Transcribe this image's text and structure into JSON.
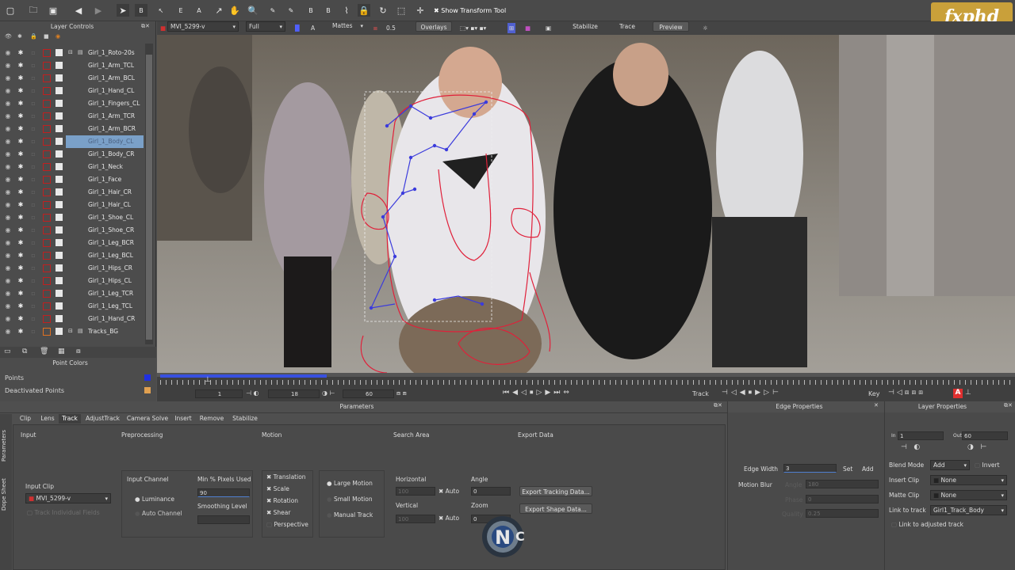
{
  "toolbar": {
    "show_transform_label": "Show Transform Tool",
    "tool_b": "B",
    "tool_e": "E",
    "tool_a": "A",
    "tool_x_b": "B",
    "tool_x_x": "X",
    "tool_b2": "B",
    "tool_b3": "B"
  },
  "logo": {
    "text": "fxphd"
  },
  "viewbar": {
    "clip": "MVI_5299-v",
    "resolution": "Full",
    "a_label": "A",
    "mattes": "Mattes",
    "opacity": "0.5",
    "overlays": "Overlays",
    "stabilize": "Stabilize",
    "trace": "Trace",
    "preview": "Preview"
  },
  "layers": {
    "title": "Layer Controls",
    "root": "Girl_1_Roto-20s",
    "items": [
      "Girl_1_Arm_TCL",
      "Girl_1_Arm_BCL",
      "Girl_1_Hand_CL",
      "Girl_1_Fingers_CL",
      "Girl_1_Arm_TCR",
      "Girl_1_Arm_BCR",
      "Girl_1_Body_CL",
      "Girl_1_Body_CR",
      "Girl_1_Neck",
      "Girl_1_Face",
      "Girl_1_Hair_CR",
      "Girl_1_Hair_CL",
      "Girl_1_Shoe_CL",
      "Girl_1_Shoe_CR",
      "Girl_1_Leg_BCR",
      "Girl_1_Leg_BCL",
      "Girl_1_Hips_CR",
      "Girl_1_Hips_CL",
      "Girl_1_Leg_TCR",
      "Girl_1_Leg_TCL",
      "Girl_1_Hand_CR"
    ],
    "selected_index": 6,
    "tracks": "Tracks_BG"
  },
  "point_colors": {
    "title": "Point Colors",
    "points": "Points",
    "deactivated": "Deactivated Points",
    "points_color": "#2030e0",
    "deactivated_color": "#e0a050"
  },
  "timeline": {
    "start": "1",
    "current": "18",
    "end": "60",
    "track_label": "Track",
    "key_label": "Key",
    "progress": 0.3
  },
  "params": {
    "title": "Parameters",
    "tabs": [
      "Clip",
      "Lens",
      "Track",
      "AdjustTrack",
      "Camera Solve",
      "Insert",
      "Remove",
      "Stabilize"
    ],
    "active_tab": "Track",
    "side_tabs": [
      "Parameters",
      "Dope Sheet"
    ],
    "sections": {
      "input": "Input",
      "preprocessing": "Preprocessing",
      "motion": "Motion",
      "search_area": "Search Area",
      "export_data": "Export Data"
    },
    "input_clip_label": "Input Clip",
    "input_clip_value": "MVI_5299-v",
    "track_individual": "Track Individual Fields",
    "input_channel_label": "Input Channel",
    "luminance": "Luminance",
    "auto_channel": "Auto Channel",
    "min_pixels_label": "Min % Pixels Used",
    "min_pixels_value": "90",
    "smoothing_label": "Smoothing Level",
    "motion_opts": [
      "Translation",
      "Scale",
      "Rotation",
      "Shear",
      "Perspective"
    ],
    "large_motion": "Large Motion",
    "small_motion": "Small Motion",
    "manual_track": "Manual Track",
    "horizontal": "Horizontal",
    "horizontal_value": "100",
    "vertical": "Vertical",
    "vertical_value": "100",
    "auto": "Auto",
    "angle": "Angle",
    "angle_value": "0",
    "zoom": "Zoom",
    "zoom_value": "0",
    "export_tracking": "Export Tracking Data...",
    "export_shape": "Export Shape Data..."
  },
  "edge": {
    "title": "Edge Properties",
    "edge_width_label": "Edge Width",
    "edge_width_value": "3",
    "set": "Set",
    "add": "Add",
    "motion_blur": "Motion Blur",
    "angle": "Angle",
    "angle_value": "180",
    "phase": "Phase",
    "phase_value": "0",
    "quality": "Quality",
    "quality_value": "0.25"
  },
  "layerprops": {
    "title": "Layer Properties",
    "in_label": "In",
    "in_value": "1",
    "out_label": "Out",
    "out_value": "60",
    "blend_label": "Blend Mode",
    "blend_value": "Add",
    "invert": "Invert",
    "insert_label": "Insert Clip",
    "insert_value": "None",
    "matte_label": "Matte Clip",
    "matte_value": "None",
    "link_label": "Link to track",
    "link_value": "Girl1_Track_Body",
    "link_adjusted": "Link to adjusted track"
  }
}
